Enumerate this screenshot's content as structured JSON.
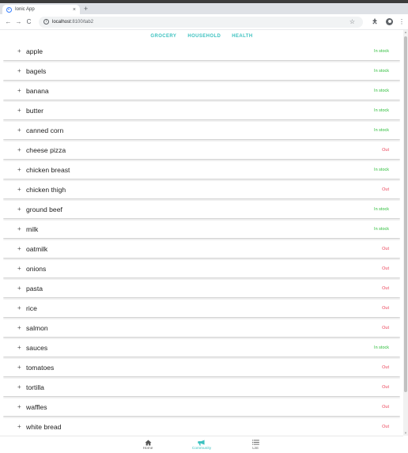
{
  "browser": {
    "tab_title": "Ionic App",
    "tab_close": "×",
    "new_tab": "+",
    "url_host": "localhost",
    "url_path": ":8100/tab2",
    "back": "←",
    "forward": "→",
    "reload": "C",
    "star": "☆",
    "menu": "⋮"
  },
  "segments": [
    {
      "label": "GROCERY"
    },
    {
      "label": "HOUSEHOLD"
    },
    {
      "label": "HEALTH"
    }
  ],
  "colors": {
    "accent": "#3dc2c0",
    "in_stock": "#2dbd3a",
    "out": "#eb445a"
  },
  "items": [
    {
      "name": "apple",
      "status": "In stock"
    },
    {
      "name": "bagels",
      "status": "In stock"
    },
    {
      "name": "banana",
      "status": "In stock"
    },
    {
      "name": "butter",
      "status": "In stock"
    },
    {
      "name": "canned corn",
      "status": "In stock"
    },
    {
      "name": "cheese pizza",
      "status": "Out"
    },
    {
      "name": "chicken breast",
      "status": "In stock"
    },
    {
      "name": "chicken thigh",
      "status": "Out"
    },
    {
      "name": "ground beef",
      "status": "In stock"
    },
    {
      "name": "milk",
      "status": "In stock"
    },
    {
      "name": "oatmilk",
      "status": "Out"
    },
    {
      "name": "onions",
      "status": "Out"
    },
    {
      "name": "pasta",
      "status": "Out"
    },
    {
      "name": "rice",
      "status": "Out"
    },
    {
      "name": "salmon",
      "status": "Out"
    },
    {
      "name": "sauces",
      "status": "In stock"
    },
    {
      "name": "tomatoes",
      "status": "Out"
    },
    {
      "name": "tortilla",
      "status": "Out"
    },
    {
      "name": "waffles",
      "status": "Out"
    },
    {
      "name": "white bread",
      "status": "Out"
    }
  ],
  "item_plus": "+",
  "bottom_tabs": [
    {
      "label": "Home",
      "icon": "home-icon",
      "active": false
    },
    {
      "label": "Community",
      "icon": "megaphone-icon",
      "active": true
    },
    {
      "label": "List",
      "icon": "list-icon",
      "active": false
    }
  ]
}
